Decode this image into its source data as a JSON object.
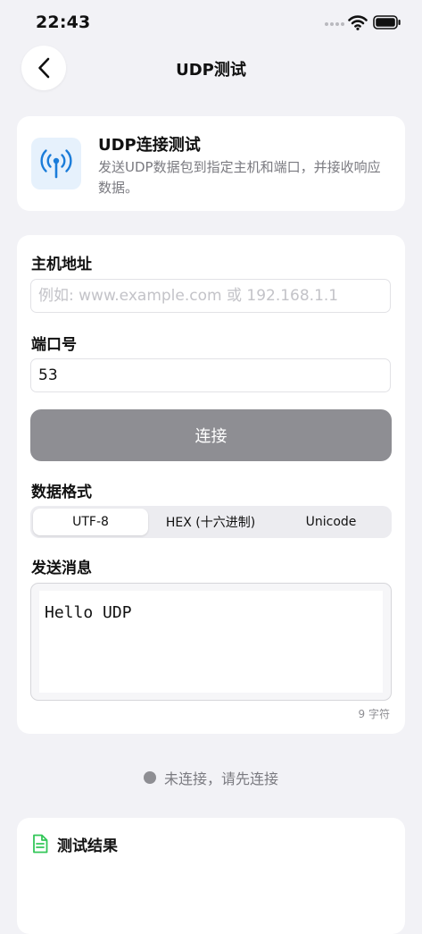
{
  "status_bar": {
    "time": "22:43"
  },
  "nav": {
    "title": "UDP测试"
  },
  "intro": {
    "title": "UDP连接测试",
    "description": "发送UDP数据包到指定主机和端口，并接收响应数据。"
  },
  "form": {
    "host_label": "主机地址",
    "host_placeholder": "例如: www.example.com 或 192.168.1.1",
    "host_value": "",
    "port_label": "端口号",
    "port_value": "53",
    "connect_label": "连接",
    "format_label": "数据格式",
    "formats": [
      "UTF-8",
      "HEX (十六进制)",
      "Unicode"
    ],
    "selected_format": "UTF-8",
    "message_label": "发送消息",
    "message_value": "Hello UDP",
    "char_count": "9 字符"
  },
  "connection": {
    "status": "未连接，请先连接"
  },
  "results": {
    "title": "测试结果"
  },
  "colors": {
    "accent": "#1a7cd9",
    "result_icon": "#34c759",
    "disabled_button": "#8e8e93",
    "background": "#f2f2f6"
  }
}
